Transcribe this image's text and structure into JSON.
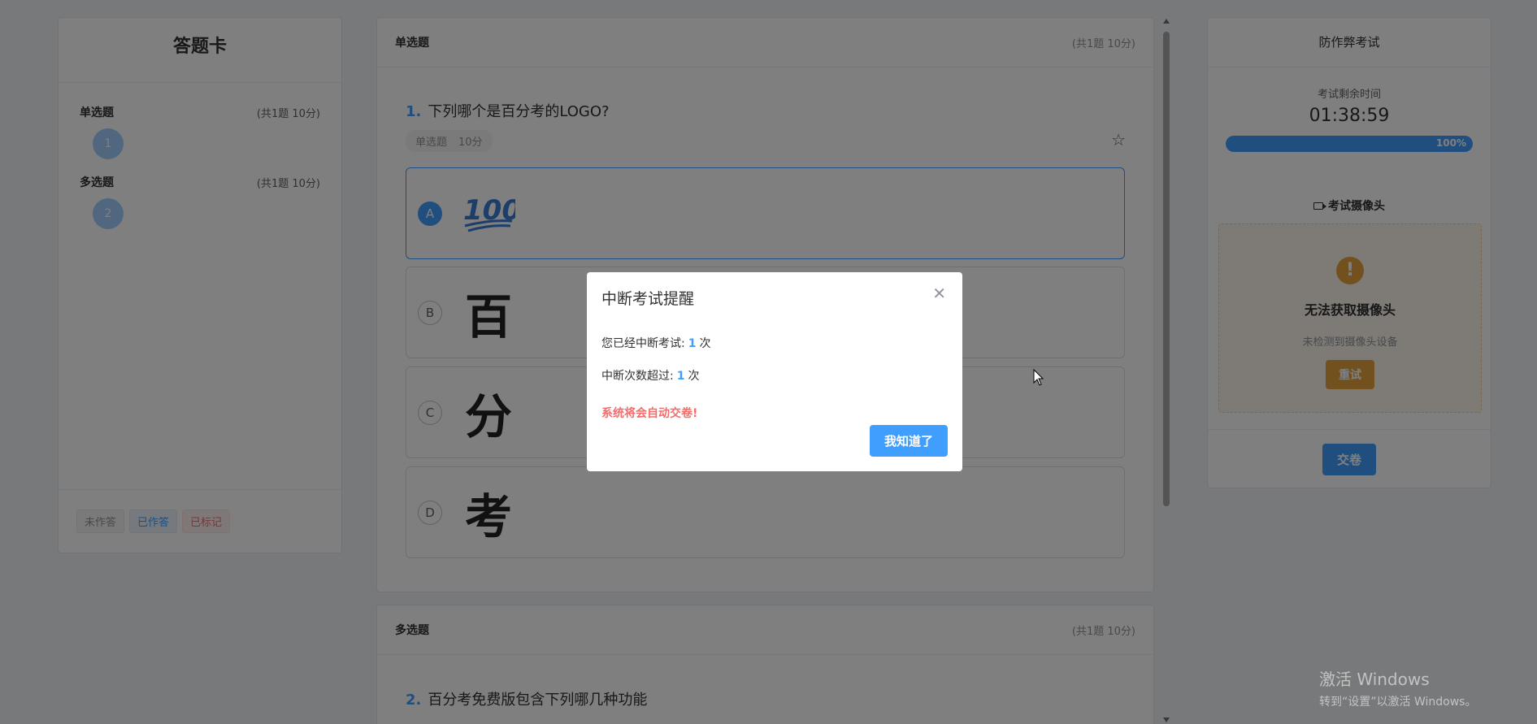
{
  "answer_card": {
    "title": "答题卡",
    "sections": [
      {
        "label": "单选题",
        "meta": "(共1题 10分)",
        "numbers": [
          "1"
        ]
      },
      {
        "label": "多选题",
        "meta": "(共1题 10分)",
        "numbers": [
          "2"
        ]
      }
    ],
    "legend": [
      "未作答",
      "已作答",
      "已标记"
    ]
  },
  "questions": [
    {
      "section_label": "单选题",
      "section_meta": "(共1题 10分)",
      "number": "1.",
      "text": "下列哪个是百分考的LOGO?",
      "type_tag": "单选题",
      "score_tag": "10分",
      "options": [
        {
          "letter": "A",
          "content": "100",
          "selected": true
        },
        {
          "letter": "B",
          "content": "百",
          "selected": false
        },
        {
          "letter": "C",
          "content": "分",
          "selected": false
        },
        {
          "letter": "D",
          "content": "考",
          "selected": false
        }
      ]
    },
    {
      "section_label": "多选题",
      "section_meta": "(共1题 10分)",
      "number": "2.",
      "text": "百分考免费版包含下列哪几种功能"
    }
  ],
  "anti_cheat": {
    "title": "防作弊考试",
    "timer_label": "考试剩余时间",
    "timer": "01:38:59",
    "progress_text": "100%",
    "progress_fraction": 1.0,
    "camera_title": "考试摄像头",
    "camera_error": "无法获取摄像头",
    "camera_sub": "未检测到摄像头设备",
    "retry_label": "重试",
    "submit_label": "交卷"
  },
  "modal": {
    "title": "中断考试提醒",
    "line1_prefix": "您已经中断考试:",
    "line1_count": "1",
    "line1_suffix": "次",
    "line2_prefix": "中断次数超过:",
    "line2_count": "1",
    "line2_suffix": "次",
    "warning": "系统将会自动交卷!",
    "confirm_label": "我知道了"
  },
  "watermark": {
    "line1": "激活 Windows",
    "line2": "转到“设置”以激活 Windows。"
  },
  "colors": {
    "primary": "#409eff",
    "warning": "#e6a23c",
    "danger": "#f56c6c"
  }
}
